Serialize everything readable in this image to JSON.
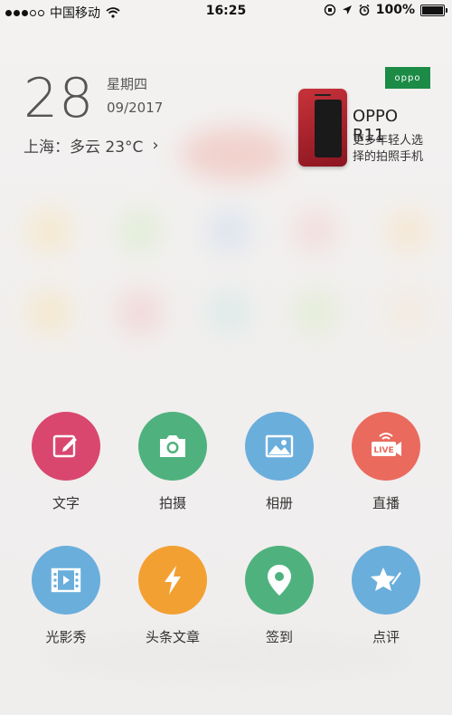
{
  "status_bar": {
    "carrier": "中国移动",
    "time": "16:25",
    "battery_text": "100%",
    "battery_level": 1.0,
    "signal_filled_dots": 3,
    "signal_total_dots": 5
  },
  "widget": {
    "day": "28",
    "weekday": "星期四",
    "month_year": "09/2017",
    "weather": "上海：多云 23°C"
  },
  "ad": {
    "brand_logo": "oppo",
    "title": "OPPO R11",
    "subtitle_line1": "更多年轻人选",
    "subtitle_line2": "择的拍照手机"
  },
  "actions": [
    {
      "label": "文字",
      "icon": "edit-icon",
      "color": "#d9476e"
    },
    {
      "label": "拍摄",
      "icon": "camera-icon",
      "color": "#4fb27e"
    },
    {
      "label": "相册",
      "icon": "image-icon",
      "color": "#6aaedc"
    },
    {
      "label": "直播",
      "icon": "live-icon",
      "color": "#ea6a5e"
    },
    {
      "label": "光影秀",
      "icon": "film-icon",
      "color": "#6aaedc"
    },
    {
      "label": "头条文章",
      "icon": "lightning-icon",
      "color": "#f3a032"
    },
    {
      "label": "签到",
      "icon": "location-pin-icon",
      "color": "#4fb27e"
    },
    {
      "label": "点评",
      "icon": "star-pen-icon",
      "color": "#6aaedc"
    }
  ]
}
